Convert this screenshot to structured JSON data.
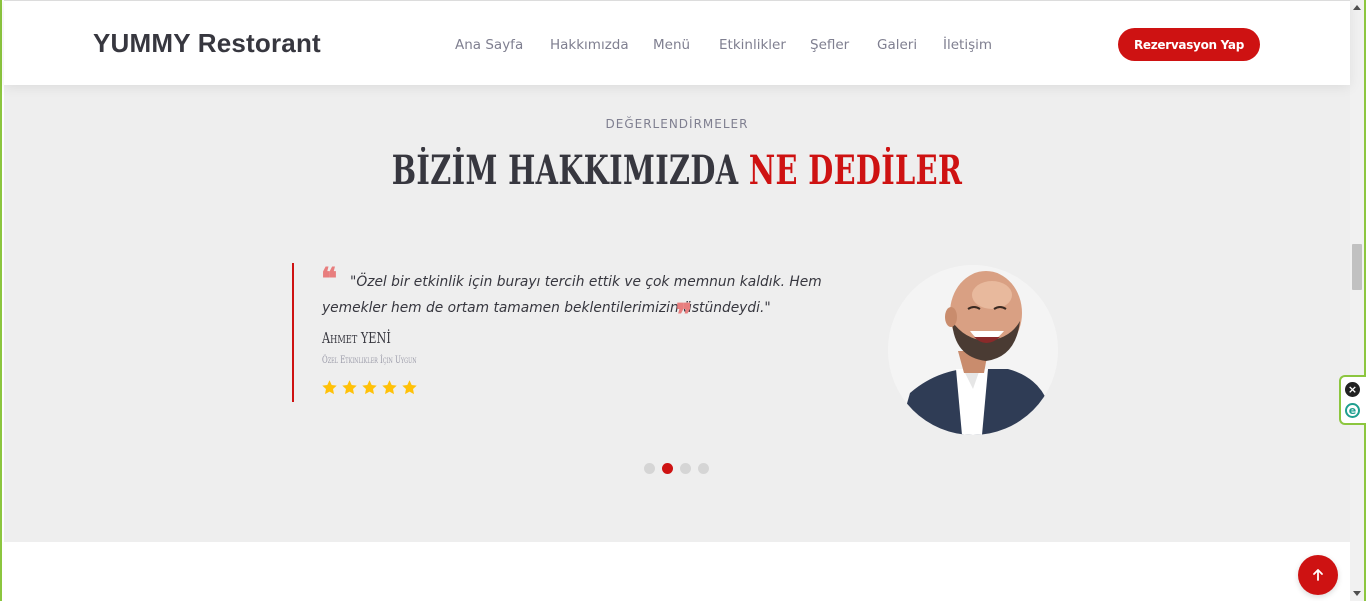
{
  "header": {
    "logo": "YUMMY Restorant",
    "nav": [
      {
        "label": "Ana Sayfa"
      },
      {
        "label": "Hakkımızda"
      },
      {
        "label": "Menü"
      },
      {
        "label": "Etkinlikler"
      },
      {
        "label": "Şefler"
      },
      {
        "label": "Galeri"
      },
      {
        "label": "İletişim"
      }
    ],
    "cta_label": "Rezervasyon Yap"
  },
  "testimonials": {
    "eyebrow": "DEĞERLENDİRMELER",
    "heading_main": "BİZİM HAKKIMIZDA ",
    "heading_accent": "NE DEDİLER",
    "quote": "\"Özel bir etkinlik için burayı tercih ettik ve çok memnun kaldık. Hem yemekler hem de ortam tamamen beklentilerimizin üstündeydi.\"",
    "name": "Ahmet YENİ",
    "role": "Özel Etkinlikler İçin Uygun",
    "rating": 5,
    "slides_total": 4,
    "active_slide": 2
  },
  "colors": {
    "accent": "#ce1212",
    "text_dark": "#37373f",
    "text_muted": "#7f7f90",
    "section_bg": "#eeeeee",
    "star": "#ffc107",
    "frame": "#8cc63f"
  },
  "icons": {
    "scroll_top": "arrow-up-icon",
    "quote_open": "quote-left-icon",
    "quote_close": "quote-right-icon",
    "star": "star-icon",
    "extension_close": "close-circle-icon",
    "extension_logo": "e-logo-icon"
  }
}
